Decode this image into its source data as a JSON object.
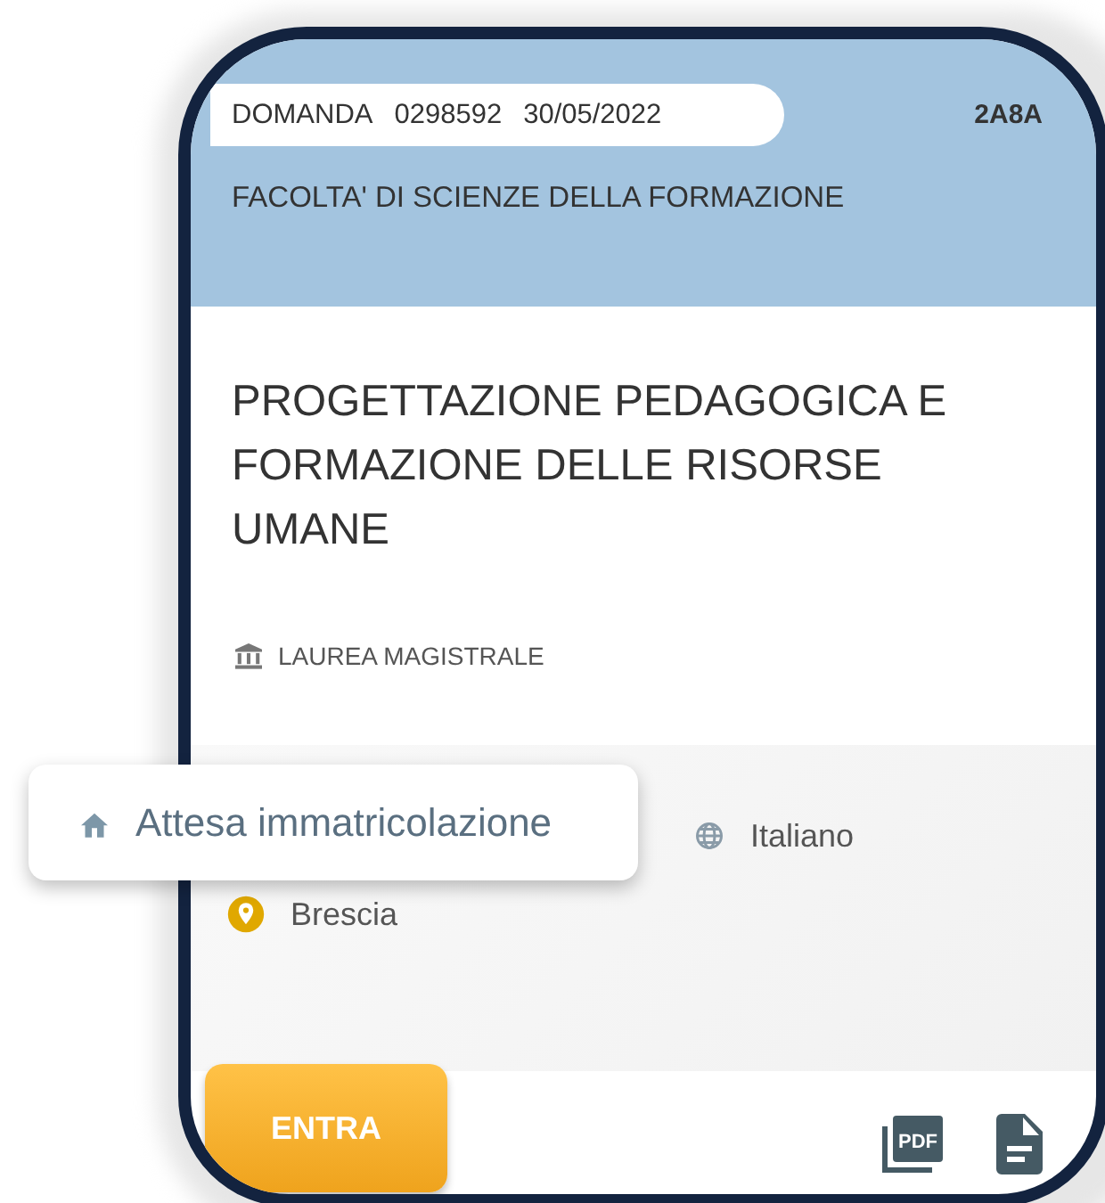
{
  "header": {
    "application_label": "DOMANDA",
    "application_number": "0298592",
    "date": "30/05/2022",
    "code": "2A8A",
    "faculty": "FACOLTA' DI SCIENZE DELLA FORMAZIONE"
  },
  "course": {
    "title": "PROGETTAZIONE PEDAGOGICA E FORMAZIONE DELLE RISORSE UMANE",
    "degree_type": "LAUREA MAGISTRALE"
  },
  "status": {
    "label": "Attesa immatricolazione"
  },
  "details": [
    {
      "kind": "language",
      "text": "Italiano"
    },
    {
      "kind": "location",
      "text": "Brescia"
    }
  ],
  "actions": {
    "enter_button": "ENTRA",
    "pdf_icon_label": "PDF"
  }
}
